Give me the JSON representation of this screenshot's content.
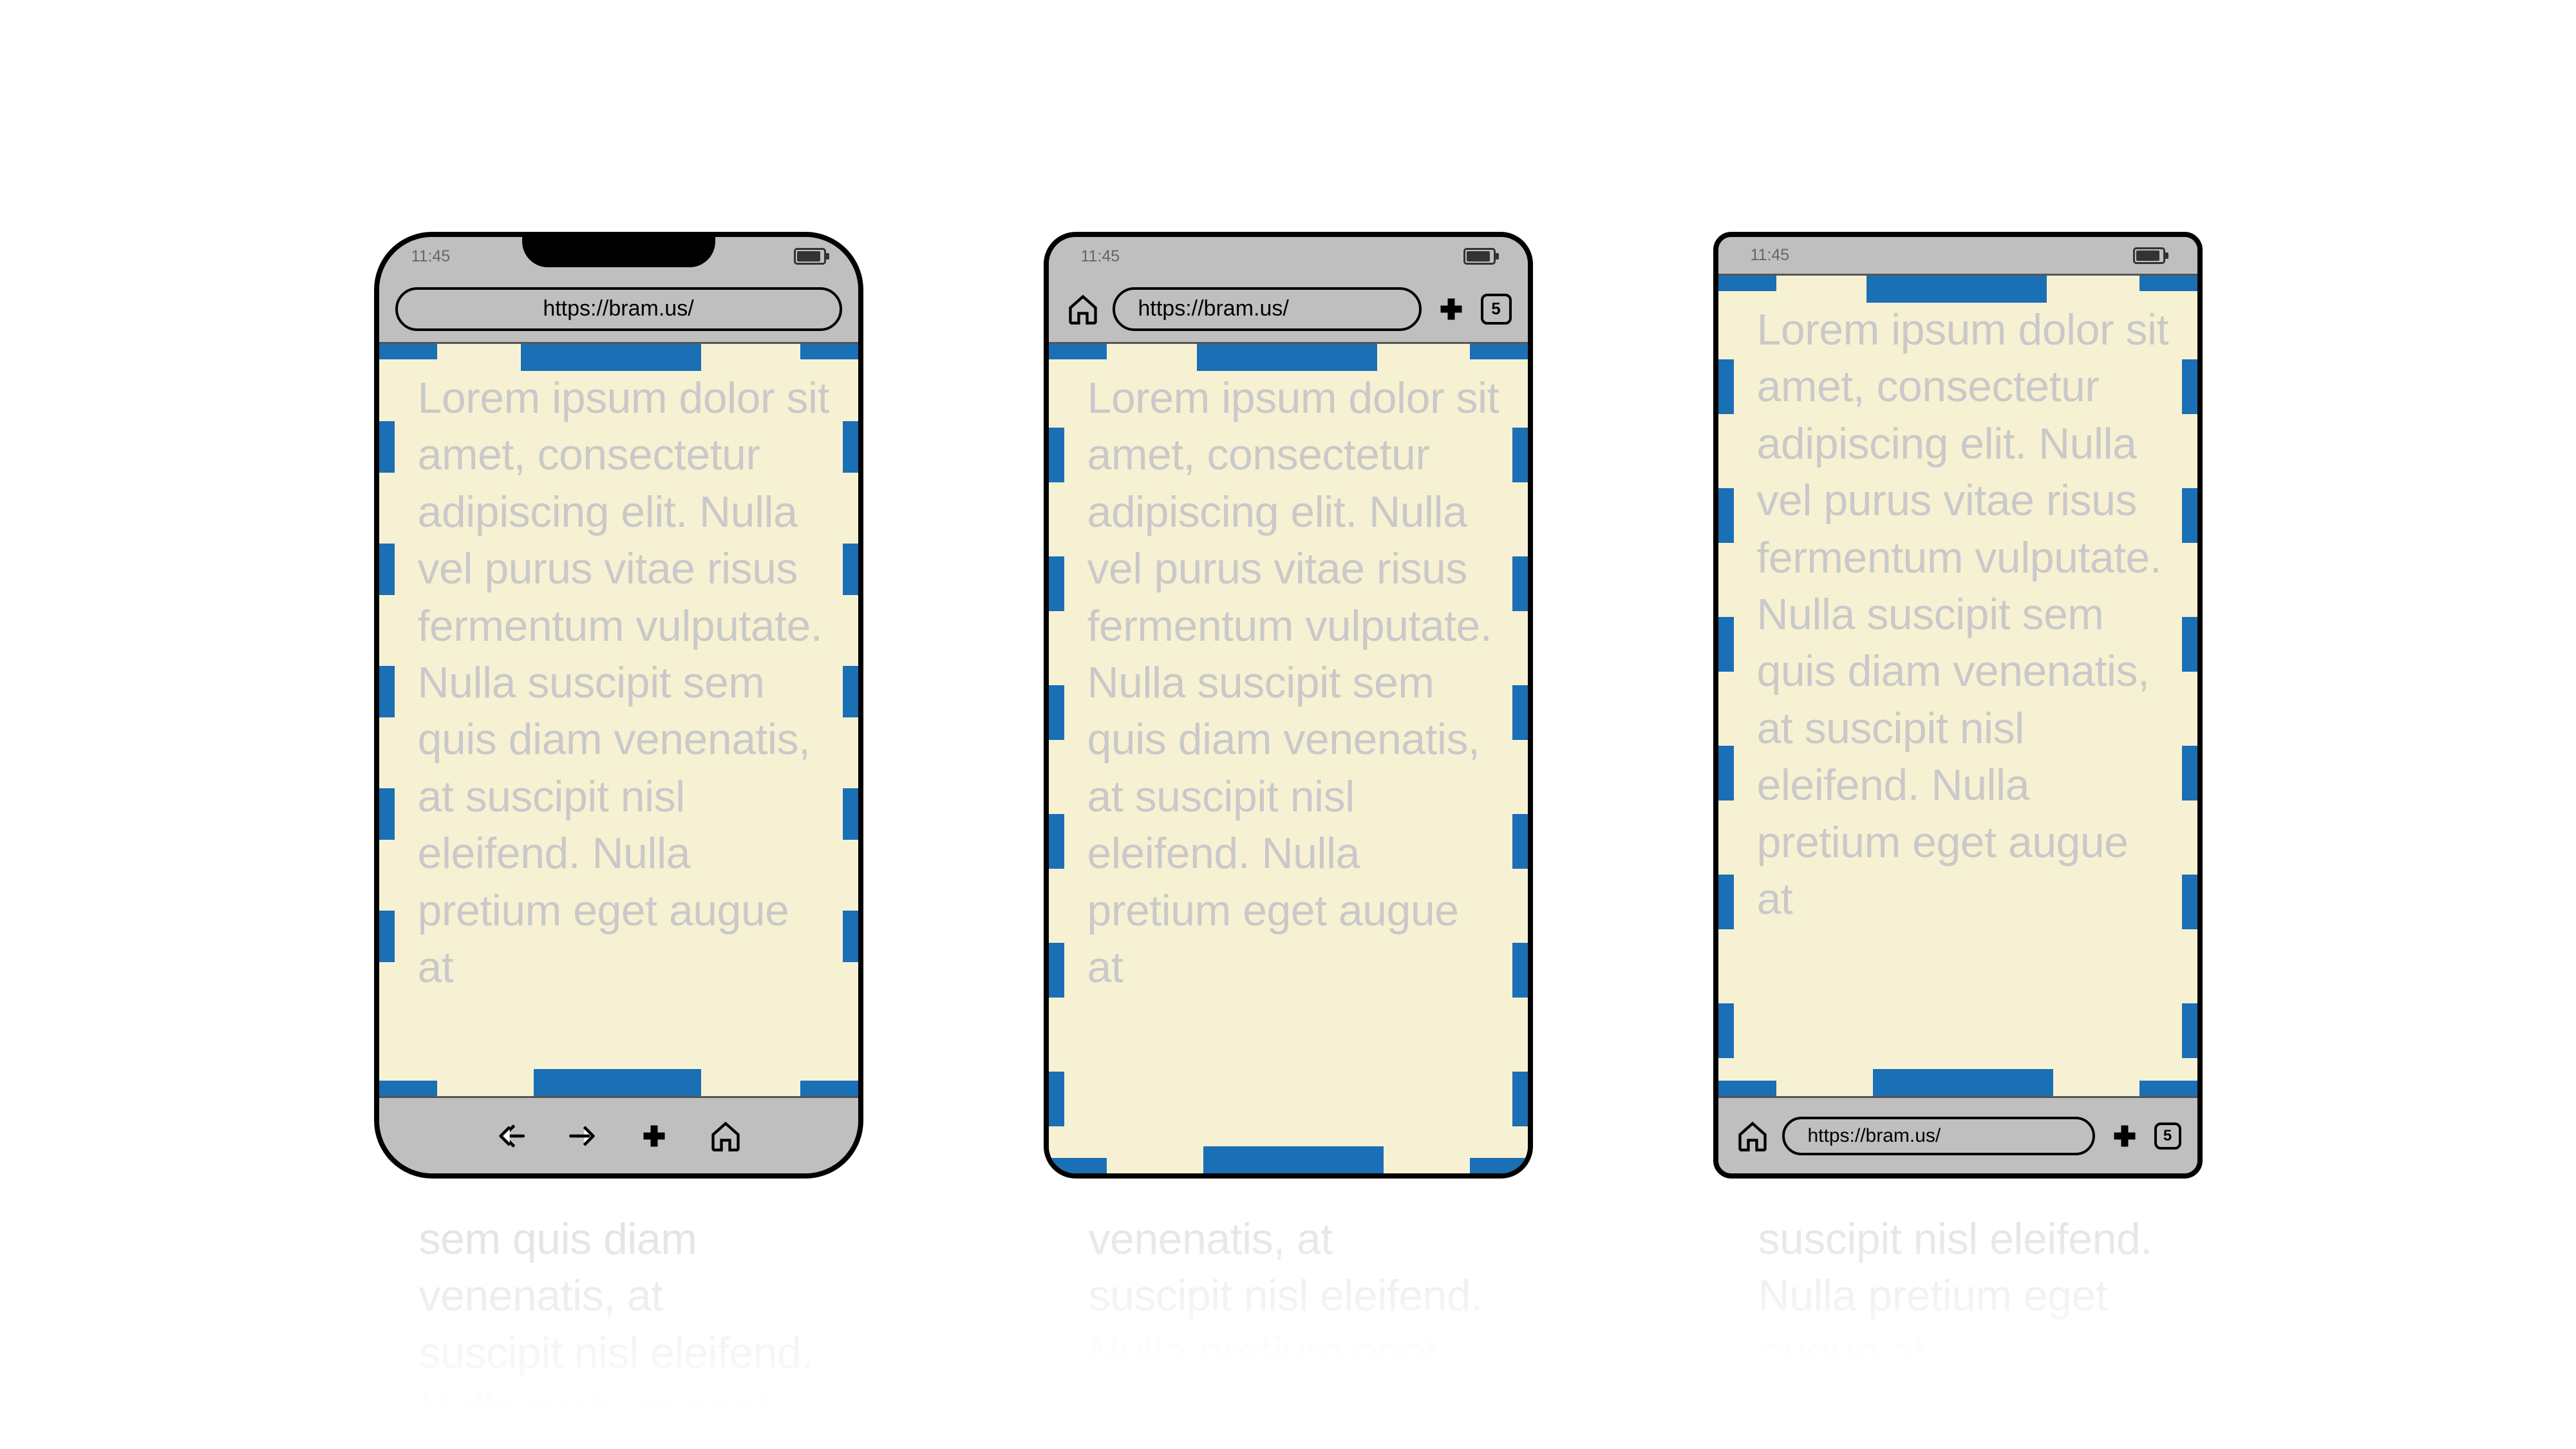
{
  "status": {
    "time": "11:45"
  },
  "url": "https://bram.us/",
  "tab_count": "5",
  "lorem_full": "Lorem ipsum dolor sit amet, consectetur adipiscing elit. Nulla vel purus vitae risus fermentum vulputate. Nulla suscipit sem quis diam venenatis, at suscipit nisl eleifend. Nulla pretium eget augue at",
  "overflow_1": "sem quis diam venenatis, at suscipit nisl eleifend. Nulla pretium eget",
  "overflow_2": "venenatis, at suscipit nisl eleifend. Nulla pretium eget",
  "overflow_3": "suscipit nisl eleifend. Nulla pretium eget augue at",
  "phones": [
    {
      "id": "phone-1",
      "desc": "rounded notch phone, url top, toolbar bottom"
    },
    {
      "id": "phone-2",
      "desc": "rounded phone, url+tabs top, no bottom bar"
    },
    {
      "id": "phone-3",
      "desc": "square phone, status top, url+tabs bottom"
    }
  ]
}
